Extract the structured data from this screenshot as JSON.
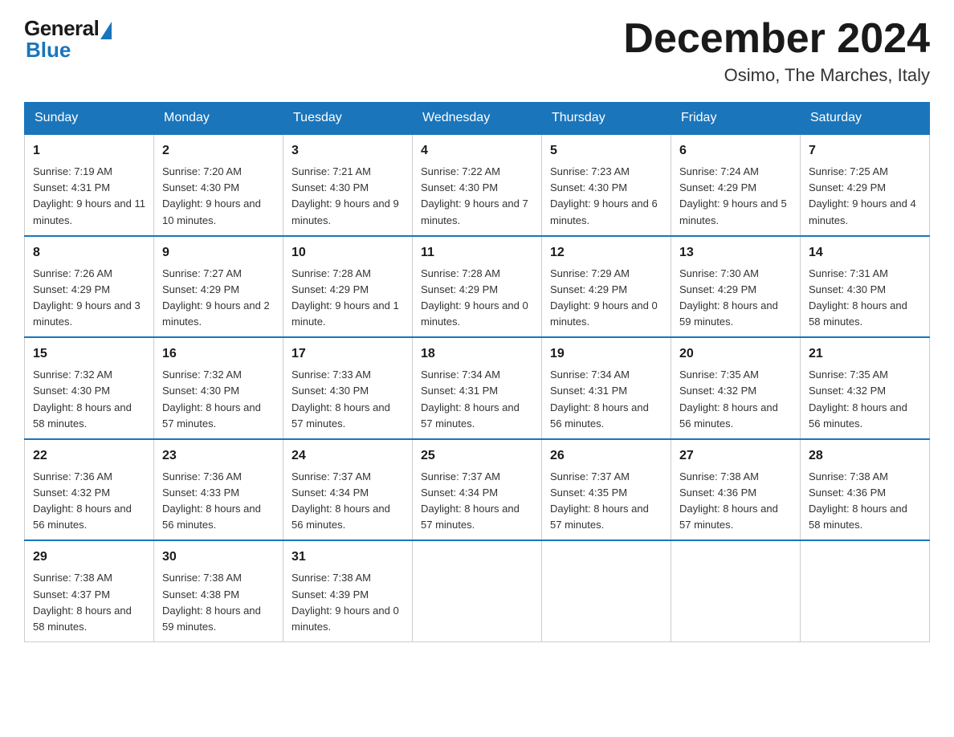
{
  "header": {
    "logo_general": "General",
    "logo_blue": "Blue",
    "month_title": "December 2024",
    "subtitle": "Osimo, The Marches, Italy"
  },
  "weekdays": [
    "Sunday",
    "Monday",
    "Tuesday",
    "Wednesday",
    "Thursday",
    "Friday",
    "Saturday"
  ],
  "weeks": [
    [
      {
        "day": "1",
        "sunrise": "7:19 AM",
        "sunset": "4:31 PM",
        "daylight": "9 hours and 11 minutes."
      },
      {
        "day": "2",
        "sunrise": "7:20 AM",
        "sunset": "4:30 PM",
        "daylight": "9 hours and 10 minutes."
      },
      {
        "day": "3",
        "sunrise": "7:21 AM",
        "sunset": "4:30 PM",
        "daylight": "9 hours and 9 minutes."
      },
      {
        "day": "4",
        "sunrise": "7:22 AM",
        "sunset": "4:30 PM",
        "daylight": "9 hours and 7 minutes."
      },
      {
        "day": "5",
        "sunrise": "7:23 AM",
        "sunset": "4:30 PM",
        "daylight": "9 hours and 6 minutes."
      },
      {
        "day": "6",
        "sunrise": "7:24 AM",
        "sunset": "4:29 PM",
        "daylight": "9 hours and 5 minutes."
      },
      {
        "day": "7",
        "sunrise": "7:25 AM",
        "sunset": "4:29 PM",
        "daylight": "9 hours and 4 minutes."
      }
    ],
    [
      {
        "day": "8",
        "sunrise": "7:26 AM",
        "sunset": "4:29 PM",
        "daylight": "9 hours and 3 minutes."
      },
      {
        "day": "9",
        "sunrise": "7:27 AM",
        "sunset": "4:29 PM",
        "daylight": "9 hours and 2 minutes."
      },
      {
        "day": "10",
        "sunrise": "7:28 AM",
        "sunset": "4:29 PM",
        "daylight": "9 hours and 1 minute."
      },
      {
        "day": "11",
        "sunrise": "7:28 AM",
        "sunset": "4:29 PM",
        "daylight": "9 hours and 0 minutes."
      },
      {
        "day": "12",
        "sunrise": "7:29 AM",
        "sunset": "4:29 PM",
        "daylight": "9 hours and 0 minutes."
      },
      {
        "day": "13",
        "sunrise": "7:30 AM",
        "sunset": "4:29 PM",
        "daylight": "8 hours and 59 minutes."
      },
      {
        "day": "14",
        "sunrise": "7:31 AM",
        "sunset": "4:30 PM",
        "daylight": "8 hours and 58 minutes."
      }
    ],
    [
      {
        "day": "15",
        "sunrise": "7:32 AM",
        "sunset": "4:30 PM",
        "daylight": "8 hours and 58 minutes."
      },
      {
        "day": "16",
        "sunrise": "7:32 AM",
        "sunset": "4:30 PM",
        "daylight": "8 hours and 57 minutes."
      },
      {
        "day": "17",
        "sunrise": "7:33 AM",
        "sunset": "4:30 PM",
        "daylight": "8 hours and 57 minutes."
      },
      {
        "day": "18",
        "sunrise": "7:34 AM",
        "sunset": "4:31 PM",
        "daylight": "8 hours and 57 minutes."
      },
      {
        "day": "19",
        "sunrise": "7:34 AM",
        "sunset": "4:31 PM",
        "daylight": "8 hours and 56 minutes."
      },
      {
        "day": "20",
        "sunrise": "7:35 AM",
        "sunset": "4:32 PM",
        "daylight": "8 hours and 56 minutes."
      },
      {
        "day": "21",
        "sunrise": "7:35 AM",
        "sunset": "4:32 PM",
        "daylight": "8 hours and 56 minutes."
      }
    ],
    [
      {
        "day": "22",
        "sunrise": "7:36 AM",
        "sunset": "4:32 PM",
        "daylight": "8 hours and 56 minutes."
      },
      {
        "day": "23",
        "sunrise": "7:36 AM",
        "sunset": "4:33 PM",
        "daylight": "8 hours and 56 minutes."
      },
      {
        "day": "24",
        "sunrise": "7:37 AM",
        "sunset": "4:34 PM",
        "daylight": "8 hours and 56 minutes."
      },
      {
        "day": "25",
        "sunrise": "7:37 AM",
        "sunset": "4:34 PM",
        "daylight": "8 hours and 57 minutes."
      },
      {
        "day": "26",
        "sunrise": "7:37 AM",
        "sunset": "4:35 PM",
        "daylight": "8 hours and 57 minutes."
      },
      {
        "day": "27",
        "sunrise": "7:38 AM",
        "sunset": "4:36 PM",
        "daylight": "8 hours and 57 minutes."
      },
      {
        "day": "28",
        "sunrise": "7:38 AM",
        "sunset": "4:36 PM",
        "daylight": "8 hours and 58 minutes."
      }
    ],
    [
      {
        "day": "29",
        "sunrise": "7:38 AM",
        "sunset": "4:37 PM",
        "daylight": "8 hours and 58 minutes."
      },
      {
        "day": "30",
        "sunrise": "7:38 AM",
        "sunset": "4:38 PM",
        "daylight": "8 hours and 59 minutes."
      },
      {
        "day": "31",
        "sunrise": "7:38 AM",
        "sunset": "4:39 PM",
        "daylight": "9 hours and 0 minutes."
      },
      null,
      null,
      null,
      null
    ]
  ],
  "labels": {
    "sunrise": "Sunrise:",
    "sunset": "Sunset:",
    "daylight": "Daylight:"
  }
}
